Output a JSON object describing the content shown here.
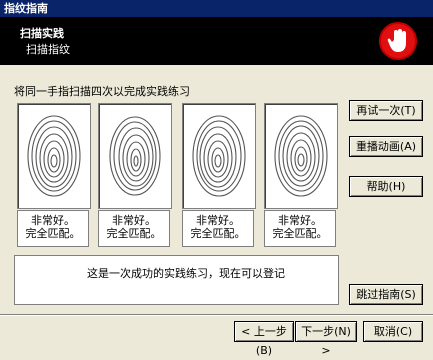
{
  "window": {
    "title": "指纹指南"
  },
  "header": {
    "title": "扫描实践",
    "subtitle": "扫描指纹"
  },
  "instruction": "将同一手指扫描四次以完成实践练习",
  "scans": [
    {
      "line1": "非常好。",
      "line2": "完全匹配。"
    },
    {
      "line1": "非常好。",
      "line2": "完全匹配。"
    },
    {
      "line1": "非常好。",
      "line2": "完全匹配。"
    },
    {
      "line1": "非常好。",
      "line2": "完全匹配。"
    }
  ],
  "message": "这是一次成功的实践练习，现在可以登记",
  "side_buttons": {
    "retry": "再试一次(T)",
    "replay": "重播动画(A)",
    "help": "帮助(H)",
    "skip": "跳过指南(S)"
  },
  "nav_buttons": {
    "back": "< 上一步(B)",
    "next": "下一步(N) >",
    "cancel": "取消(C)"
  },
  "colors": {
    "header_bg": "#000000",
    "title_bg": "#0a246a",
    "logo_red": "#e01010",
    "dialog_bg": "#ece9d8"
  },
  "icons": {
    "logo": "fingerprint-hand-icon"
  }
}
